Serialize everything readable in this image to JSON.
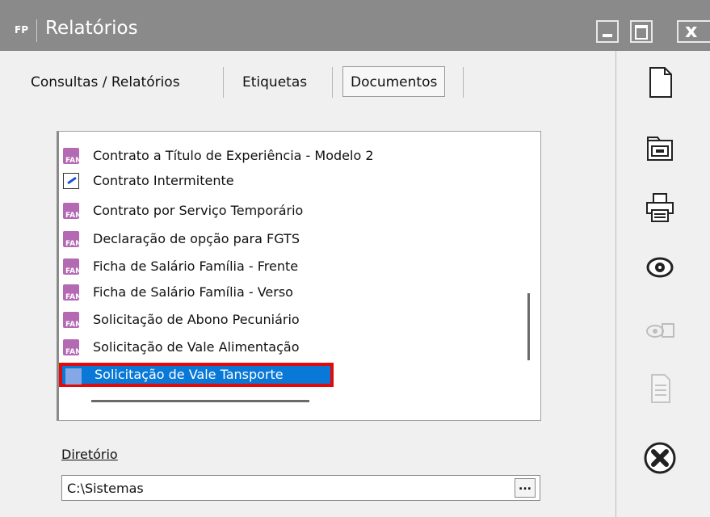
{
  "window": {
    "badge": "FP",
    "title": "Relatórios"
  },
  "tabs": [
    {
      "label": "Consultas / Relatórios"
    },
    {
      "label": "Etiquetas"
    },
    {
      "label": "Documentos",
      "active": true
    }
  ],
  "list": {
    "items": [
      {
        "label": "Contrato a Título de Experiência - Modelo 2",
        "icon": "family-report-icon"
      },
      {
        "label": "Contrato Intermitente",
        "icon": "notepad-icon"
      },
      {
        "label": "Contrato por Serviço Temporário",
        "icon": "family-report-icon"
      },
      {
        "label": "Declaração de opção para FGTS",
        "icon": "family-report-icon"
      },
      {
        "label": "Ficha de Salário Família - Frente",
        "icon": "family-report-icon"
      },
      {
        "label": "Ficha de Salário Família - Verso",
        "icon": "family-report-icon"
      },
      {
        "label": "Solicitação de Abono Pecuniário",
        "icon": "family-report-icon"
      },
      {
        "label": "Solicitação de Vale Alimentação",
        "icon": "family-report-icon"
      }
    ],
    "selected": {
      "label": "Solicitação de Vale Tansporte",
      "icon": "family-report-icon"
    }
  },
  "directory": {
    "label": "Diretório",
    "value": "C:\\Sistemas",
    "browse_label": "..."
  },
  "sidebar_icons": [
    "new-document-icon",
    "open-folder-icon",
    "print-icon",
    "preview-icon",
    "preview-multi-icon",
    "export-icon",
    "close-circle-icon"
  ],
  "colors": {
    "titlebar": "#8a8a8a",
    "selection": "#0a78d7",
    "highlight_border": "#e10b0b"
  }
}
